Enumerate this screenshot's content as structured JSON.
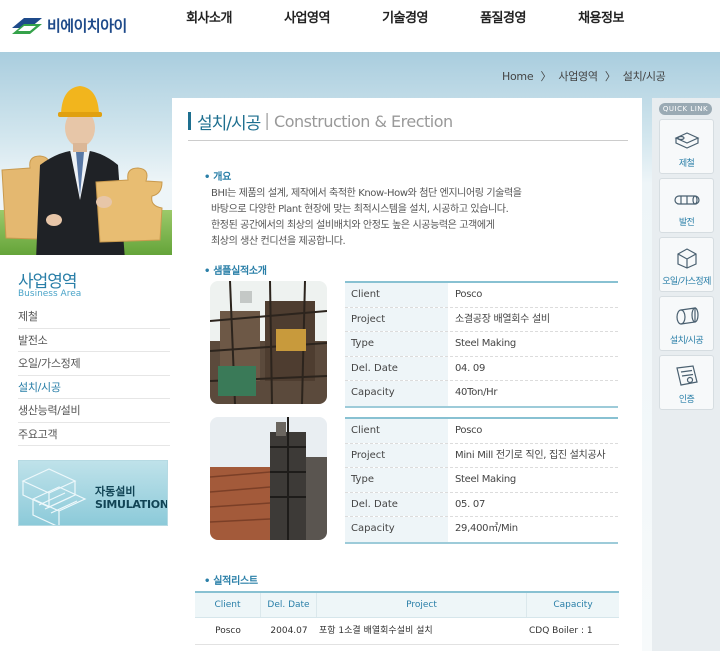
{
  "brand": {
    "name": "비에이치아이"
  },
  "gnb": [
    "회사소개",
    "사업영역",
    "기술경영",
    "품질경영",
    "채용정보"
  ],
  "breadcrumb": {
    "home": "Home",
    "sep": "〉",
    "level1": "사업영역",
    "level2": "설치/시공"
  },
  "sidebar": {
    "title": "사업영역",
    "subtitle": "Business Area",
    "items": [
      "제철",
      "발전소",
      "오일/가스정제",
      "설치/시공",
      "생산능력/설비",
      "주요고객"
    ],
    "active_index": 3,
    "banner": {
      "line1": "자동설비",
      "line2": "SIMULATION"
    }
  },
  "page": {
    "title_ko": "설치/시공",
    "separator": "|",
    "title_en": "Construction & Erection"
  },
  "overview": {
    "heading": "개요",
    "lines": [
      "BHI는 제품의 설계, 제작에서 축적한 Know-How와 첨단 엔지니어링 기술력을",
      "바탕으로 다양한 Plant 현장에 맞는 최적시스템을 설치, 시공하고 있습니다.",
      "한정된 공간에서의 최상의 설비배치와 안정도 높은 시공능력은 고객에게",
      "최상의 생산 컨디션을 제공합니다."
    ]
  },
  "samples": {
    "heading": "샘플실적소개",
    "labels": {
      "client": "Client",
      "project": "Project",
      "type": "Type",
      "del_date": "Del. Date",
      "capacity": "Capacity"
    },
    "items": [
      {
        "client": "Posco",
        "project": "소결공장 배열회수 설비",
        "type": "Steel Making",
        "del_date": "04. 09",
        "capacity": "40Ton/Hr"
      },
      {
        "client": "Posco",
        "project": "Mini Mill 전기로 직인, 집진 설치공사",
        "type": "Steel Making",
        "del_date": "05. 07",
        "capacity": "29,400㎥/Min"
      }
    ]
  },
  "records": {
    "heading": "실적리스트",
    "columns": [
      "Client",
      "Del. Date",
      "Project",
      "Capacity"
    ],
    "rows": [
      {
        "client": "Posco",
        "del_date": "2004.07",
        "project": "포항 1소결 배열회수설비 설치",
        "capacity": "CDQ Boiler : 1"
      }
    ]
  },
  "quicklink": {
    "label": "QUICK LINK",
    "items": [
      {
        "label": "제철",
        "icon": "steel-icon"
      },
      {
        "label": "발전",
        "icon": "power-icon"
      },
      {
        "label": "오일/가스정제",
        "icon": "oil-gas-icon"
      },
      {
        "label": "설치/시공",
        "icon": "construction-icon"
      },
      {
        "label": "인증",
        "icon": "certificate-icon"
      }
    ]
  },
  "colors": {
    "accent": "#2a7fa8",
    "brand": "#1e4a8a",
    "table_border": "#88c1d2"
  }
}
